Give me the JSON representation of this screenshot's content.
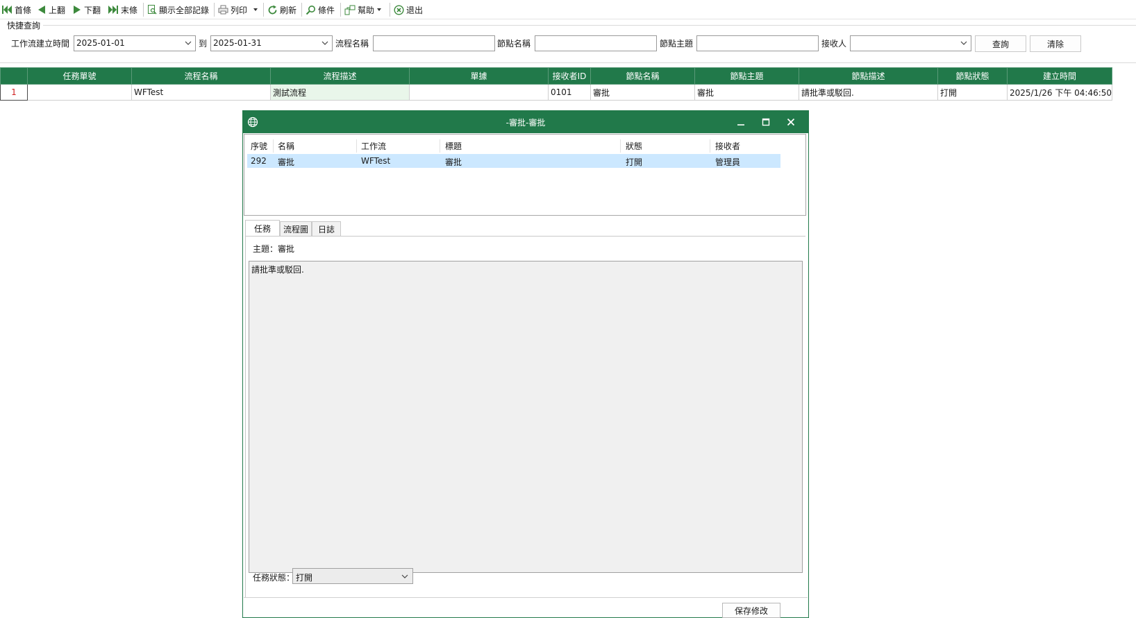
{
  "toolbar": {
    "first": "首條",
    "prev": "上翻",
    "next": "下翻",
    "last": "末條",
    "show_all": "顯示全部記錄",
    "print": "列印",
    "refresh": "刷新",
    "conditions": "條件",
    "help": "幫助",
    "exit": "退出"
  },
  "quick_query": {
    "title": "快捷查詢",
    "created_label": "工作流建立時間",
    "date_from": "2025-01-01",
    "to_label": "到",
    "date_to": "2025-01-31",
    "flow_name_label": "流程名稱",
    "flow_name_value": "",
    "node_name_label": "節點名稱",
    "node_name_value": "",
    "node_subject_label": "節點主題",
    "node_subject_value": "",
    "receiver_label": "接收人",
    "receiver_value": "",
    "query_button": "查詢",
    "clear_button": "清除"
  },
  "grid": {
    "columns": [
      "任務單號",
      "流程名稱",
      "流程描述",
      "單據",
      "接收者ID",
      "節點名稱",
      "節點主題",
      "節點描述",
      "節點狀態",
      "建立時間"
    ],
    "rows": [
      {
        "num": "1",
        "task_no": "",
        "flow_name": "WFTest",
        "flow_desc": "測試流程",
        "document": "",
        "receiver_id": "0101",
        "node_name": "審批",
        "node_subject": "審批",
        "node_desc": "請批準或駁回.",
        "node_status": "打開",
        "created": "2025/1/26 下午 04:46:50"
      }
    ]
  },
  "dialog": {
    "title": "-審批-審批",
    "list": {
      "columns": [
        "序號",
        "名稱",
        "工作流",
        "標題",
        "狀態",
        "接收者"
      ],
      "rows": [
        {
          "seq": "292",
          "name": "審批",
          "workflow": "WFTest",
          "title": "審批",
          "status": "打開",
          "receiver": "管理員"
        }
      ]
    },
    "tabs": [
      "任務",
      "流程圖",
      "日誌"
    ],
    "subject_label": "主題：",
    "subject_value": "審批",
    "description": "請批準或駁回.",
    "status_label": "任務狀態：",
    "status_value": "打開",
    "save_button": "保存修改"
  },
  "colors": {
    "accent": "#21794a",
    "selected_row": "#cce8ff",
    "row_number": "#d02020"
  }
}
